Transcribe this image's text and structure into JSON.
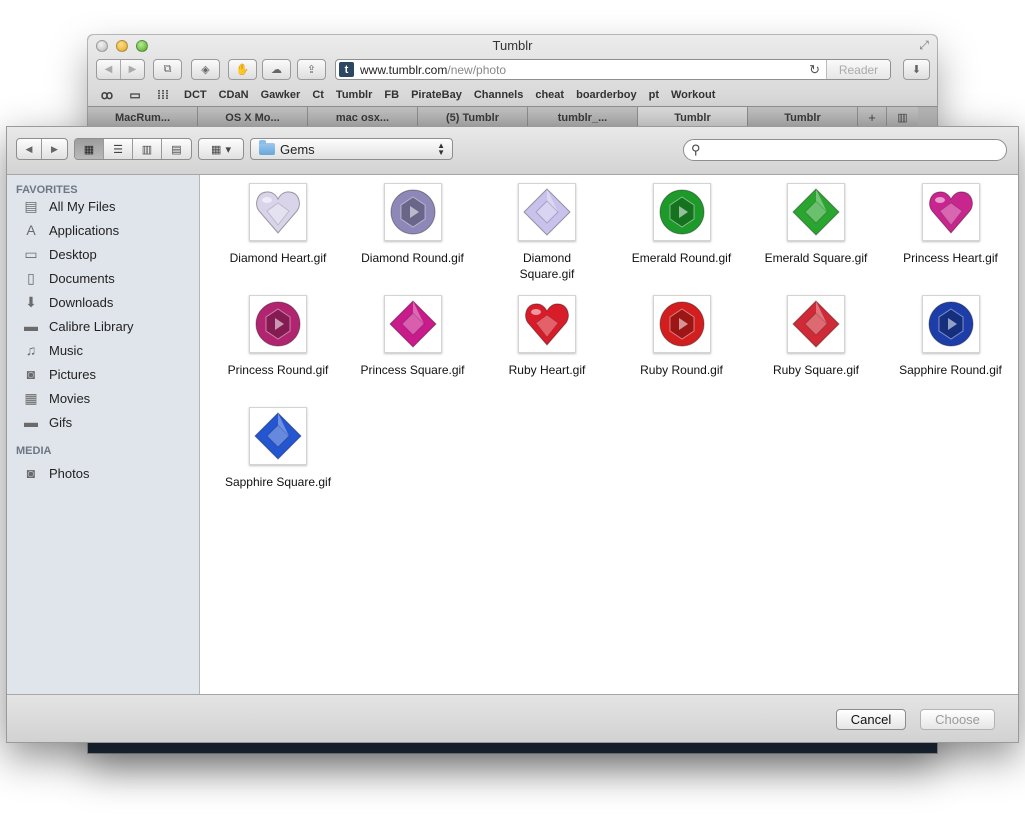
{
  "browser": {
    "title": "Tumblr",
    "address": {
      "host": "www.tumblr.com",
      "path": "/new/photo",
      "favicon": "t"
    },
    "reader_label": "Reader",
    "bookmarks": [
      "DCT",
      "CDaN",
      "Gawker",
      "Ct",
      "Tumblr",
      "FB",
      "PirateBay",
      "Channels",
      "cheat",
      "boarderboy",
      "pt",
      "Workout"
    ],
    "tabs": [
      "MacRum...",
      "OS X Mo...",
      "mac osx...",
      "(5) Tumblr",
      "tumblr_...",
      "Tumblr",
      "Tumblr"
    ],
    "active_tab_index": 5
  },
  "dialog": {
    "location": "Gems",
    "search": {
      "value": "",
      "placeholder": ""
    },
    "sidebar": {
      "favorites_heading": "FAVORITES",
      "favorites": [
        {
          "label": "All My Files",
          "icon": "all-files-icon"
        },
        {
          "label": "Applications",
          "icon": "applications-icon"
        },
        {
          "label": "Desktop",
          "icon": "desktop-icon"
        },
        {
          "label": "Documents",
          "icon": "documents-icon"
        },
        {
          "label": "Downloads",
          "icon": "downloads-icon"
        },
        {
          "label": "Calibre Library",
          "icon": "folder-icon"
        },
        {
          "label": "Music",
          "icon": "music-icon"
        },
        {
          "label": "Pictures",
          "icon": "camera-icon"
        },
        {
          "label": "Movies",
          "icon": "film-icon"
        },
        {
          "label": "Gifs",
          "icon": "folder-icon"
        }
      ],
      "media_heading": "MEDIA",
      "media": [
        {
          "label": "Photos",
          "icon": "camera-icon"
        }
      ]
    },
    "files": [
      {
        "name": "Diamond Heart.gif",
        "shape": "heart",
        "color": "#d9d4ea"
      },
      {
        "name": "Diamond Round.gif",
        "shape": "round",
        "color": "#8d88b8"
      },
      {
        "name": "Diamond Square.gif",
        "shape": "square",
        "color": "#c9c2ec"
      },
      {
        "name": "Emerald Round.gif",
        "shape": "round",
        "color": "#1d9a2a"
      },
      {
        "name": "Emerald Square.gif",
        "shape": "square",
        "color": "#2aa52f"
      },
      {
        "name": "Princess Heart.gif",
        "shape": "heart",
        "color": "#c8258e"
      },
      {
        "name": "Princess Round.gif",
        "shape": "round",
        "color": "#b1246f"
      },
      {
        "name": "Princess Square.gif",
        "shape": "square",
        "color": "#c91b8b"
      },
      {
        "name": "Ruby Heart.gif",
        "shape": "heart",
        "color": "#d81d2a"
      },
      {
        "name": "Ruby Round.gif",
        "shape": "round",
        "color": "#d21e1e"
      },
      {
        "name": "Ruby Square.gif",
        "shape": "square",
        "color": "#cf2a35"
      },
      {
        "name": "Sapphire Round.gif",
        "shape": "round",
        "color": "#1d3ea8"
      },
      {
        "name": "Sapphire Square.gif",
        "shape": "square",
        "color": "#2456d2"
      }
    ],
    "buttons": {
      "cancel": "Cancel",
      "choose": "Choose"
    }
  }
}
